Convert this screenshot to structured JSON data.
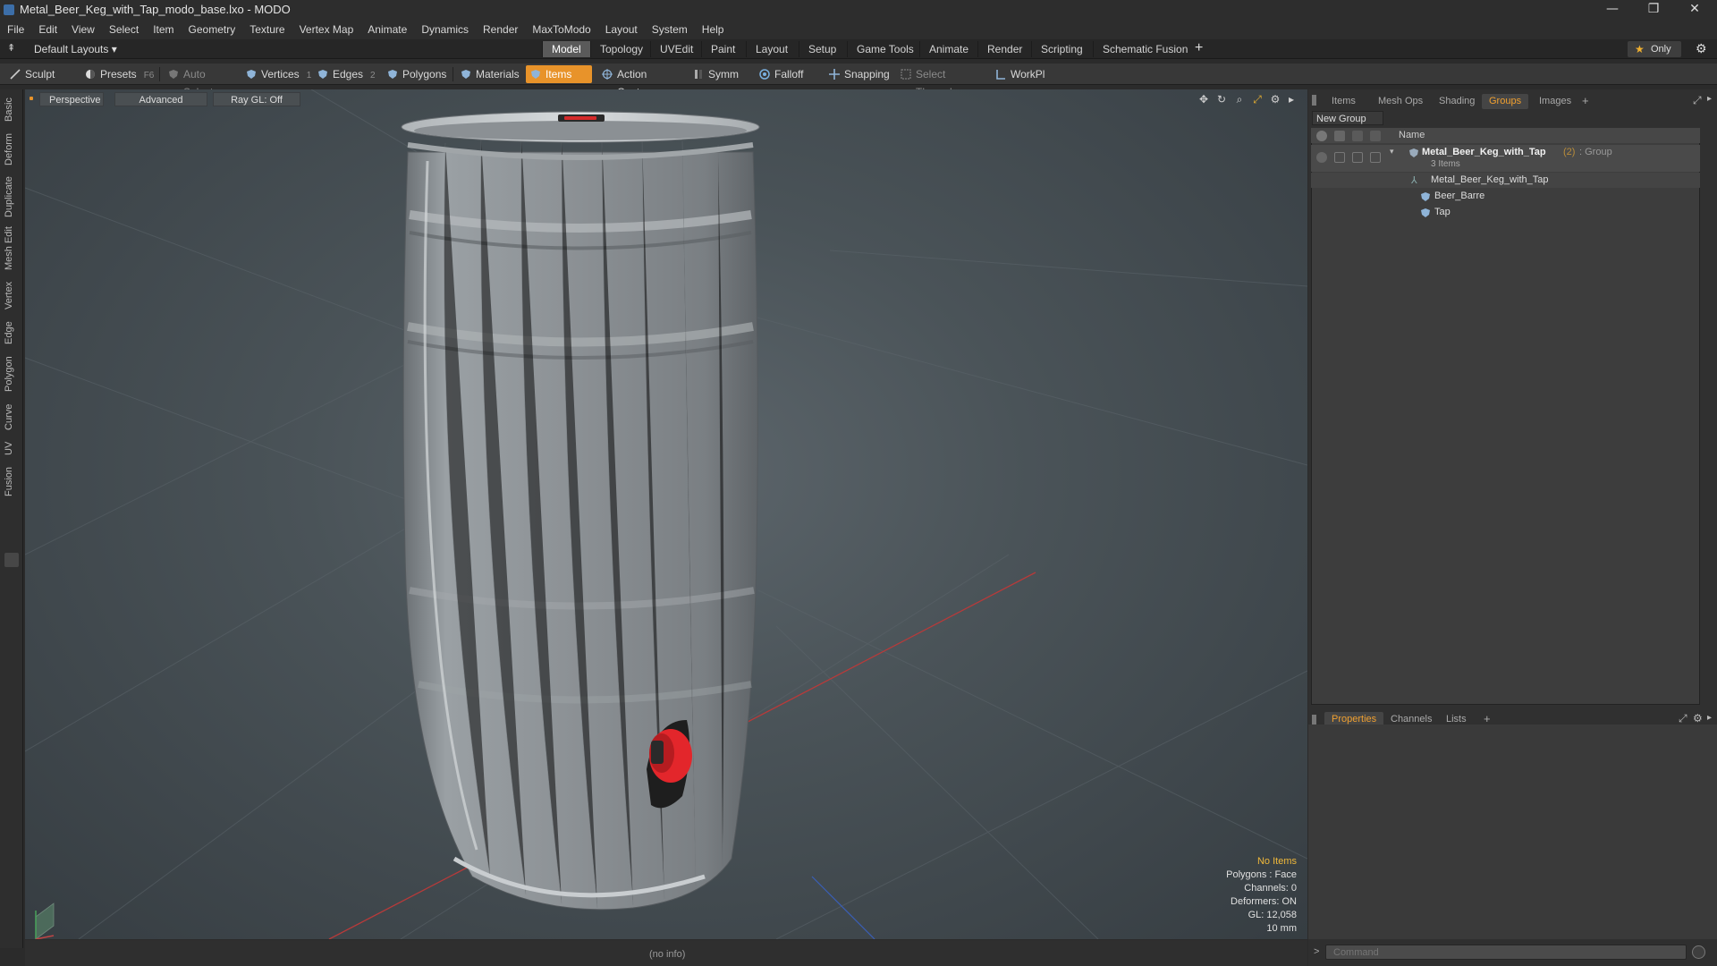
{
  "window": {
    "title": "Metal_Beer_Keg_with_Tap_modo_base.lxo - MODO",
    "minimize": "—",
    "restore": "❐",
    "close": "✕"
  },
  "menu": [
    "File",
    "Edit",
    "View",
    "Select",
    "Item",
    "Geometry",
    "Texture",
    "Vertex Map",
    "Animate",
    "Dynamics",
    "Render",
    "MaxToModo",
    "Layout",
    "System",
    "Help"
  ],
  "layoutbar": {
    "layouts_label": "Default Layouts ▾",
    "tabs": [
      "Model",
      "Topology",
      "UVEdit",
      "Paint",
      "Layout",
      "Setup",
      "Game Tools",
      "Animate",
      "Render",
      "Scripting",
      "Schematic Fusion"
    ],
    "active_tab": "Model",
    "add": "+",
    "only_label": "Only"
  },
  "toolbar": {
    "sculpt": "Sculpt",
    "presets": "Presets",
    "presets_key": "F6",
    "auto_select": "Auto Select",
    "vertices": "Vertices",
    "vertices_count": "1",
    "edges": "Edges",
    "edges_count": "2",
    "polygons": "Polygons",
    "materials": "Materials",
    "items": "Items",
    "action_center": "Action Center",
    "symmetry": "Symm ...",
    "falloff": "Falloff",
    "snapping": "Snapping",
    "select_through": "Select Through",
    "workplane": "WorkPl ..."
  },
  "left_tabs": [
    "Basic",
    "Deform",
    "Duplicate",
    "Mesh Edit",
    "Vertex",
    "Edge",
    "Polygon",
    "Curve",
    "UV",
    "Fusion"
  ],
  "viewport": {
    "perspective": "Perspective",
    "advanced": "Advanced",
    "raygl": "Ray GL: Off",
    "info": {
      "no_items": "No Items",
      "polygons": "Polygons : Face",
      "channels": "Channels: 0",
      "deformers": "Deformers: ON",
      "gl": "GL: 12,058",
      "grid": "10 mm"
    }
  },
  "status": {
    "info": "(no info)"
  },
  "right_panel": {
    "tabs": [
      "Items",
      "Mesh Ops",
      "Shading",
      "Groups",
      "Images"
    ],
    "active_tab": "Groups",
    "add": "+",
    "new_group": "New Group",
    "name_col": "Name",
    "group": {
      "name": "Metal_Beer_Keg_with_Tap",
      "count": "(2)",
      "kind": ": Group",
      "items_count": "3 Items"
    },
    "children": [
      "Metal_Beer_Keg_with_Tap",
      "Beer_Barre",
      "Tap"
    ],
    "bottom_tabs": [
      "Properties",
      "Channels",
      "Lists"
    ],
    "bottom_active": "Properties",
    "command_placeholder": "Command"
  },
  "colors": {
    "accent": "#e8932a",
    "tap_red": "#e3262b",
    "keg_grey": "#8e9396"
  }
}
